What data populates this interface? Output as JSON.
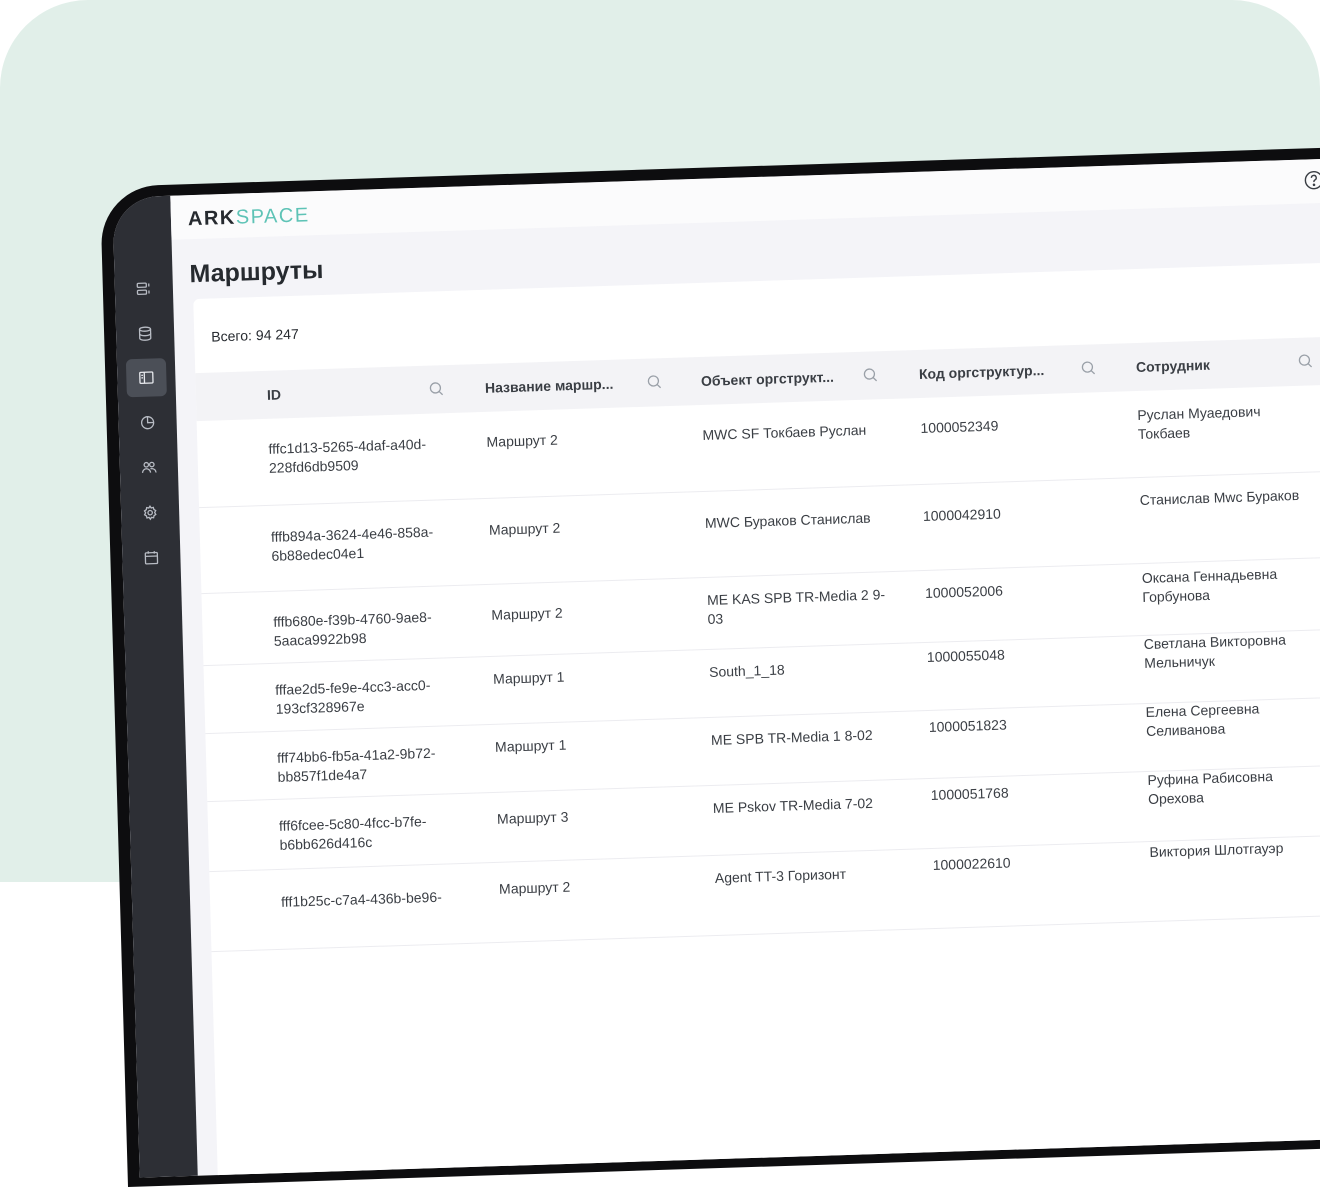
{
  "app": {
    "logo_ark": "ARK",
    "logo_space": "SPACE"
  },
  "page": {
    "title": "Маршруты",
    "total_label": "Всего:",
    "total_value": "94 247"
  },
  "sidebar": {
    "items": [
      {
        "icon": "list-icon",
        "active": false
      },
      {
        "icon": "database-icon",
        "active": false
      },
      {
        "icon": "routes-panel-icon",
        "active": true
      },
      {
        "icon": "pie-chart-icon",
        "active": false
      },
      {
        "icon": "users-icon",
        "active": false
      },
      {
        "icon": "gear-icon",
        "active": false
      },
      {
        "icon": "calendar-icon",
        "active": false
      }
    ]
  },
  "table": {
    "columns": [
      {
        "label": "ID"
      },
      {
        "label": "Название маршр..."
      },
      {
        "label": "Объект оргструкт..."
      },
      {
        "label": "Код оргструктур..."
      },
      {
        "label": "Сотрудник"
      }
    ],
    "rows": [
      {
        "id": "fffc1d13-5265-4daf-a40d-228fd6db9509",
        "name": "Маршрут 2",
        "object": "MWC SF Токбаев Руслан",
        "code": "1000052349",
        "employee": "Руслан Муаедович Токбаев"
      },
      {
        "id": "fffb894a-3624-4e46-858a-6b88edec04e1",
        "name": "Маршрут 2",
        "object": "MWC Бураков Станислав",
        "code": "1000042910",
        "employee": "Станислав Mwc Бураков"
      },
      {
        "id": "fffb680e-f39b-4760-9ae8-5aaca9922b98",
        "name": "Маршрут 2",
        "object": "ME KAS SPB TR-Media 2 9-03",
        "code": "1000052006",
        "employee": "Оксана Геннадьевна Горбунова"
      },
      {
        "id": "fffae2d5-fe9e-4cc3-acc0-193cf328967e",
        "name": "Маршрут 1",
        "object": "South_1_18",
        "code": "1000055048",
        "employee": "Светлана Викторовна Мельничук"
      },
      {
        "id": "fff74bb6-fb5a-41a2-9b72-bb857f1de4a7",
        "name": "Маршрут 1",
        "object": "ME SPB TR-Media 1 8-02",
        "code": "1000051823",
        "employee": "Елена Сергеевна Селиванова"
      },
      {
        "id": "fff6fcee-5c80-4fcc-b7fe-b6bb626d416c",
        "name": "Маршрут 3",
        "object": "ME Pskov TR-Media 7-02",
        "code": "1000051768",
        "employee": "Руфина Рабисовна Орехова"
      },
      {
        "id": "fff1b25c-c7a4-436b-be96-",
        "name": "Маршрут 2",
        "object": "Agent TT-3 Горизонт",
        "code": "1000022610",
        "employee": "Виктория Шлотгауэр"
      }
    ]
  }
}
